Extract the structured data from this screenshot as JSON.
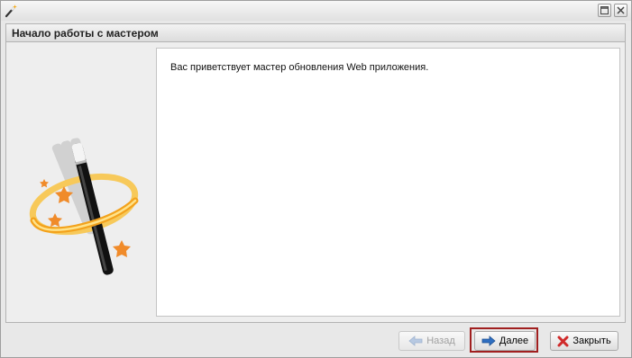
{
  "window": {
    "icon": "magic-wand-icon",
    "maximize_icon": "maximize-icon",
    "close_icon": "close-icon"
  },
  "panel": {
    "title": "Начало работы с мастером",
    "welcome_text": "Вас приветствует мастер обновления Web приложения."
  },
  "buttons": {
    "back_label": "Назад",
    "back_icon": "arrow-left-icon",
    "next_label": "Далее",
    "next_icon": "arrow-right-icon",
    "close_label": "Закрыть",
    "close_icon": "red-x-icon"
  },
  "colors": {
    "highlight": "#a01f1f",
    "arrow_blue": "#2f6fc1",
    "close_red": "#d02a2a",
    "ring_orange": "#f3a21c"
  }
}
